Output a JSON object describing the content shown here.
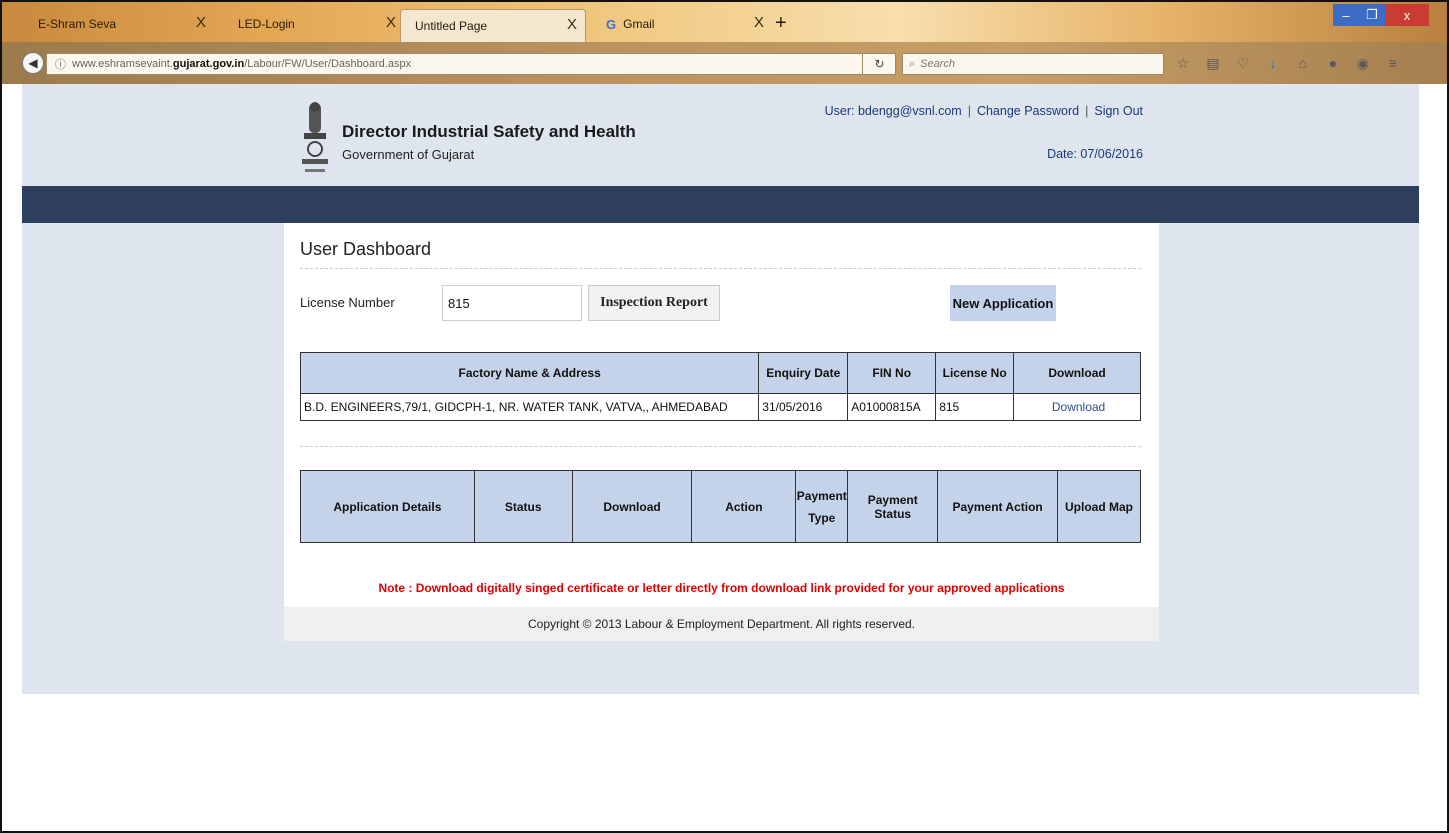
{
  "browser": {
    "tabs": [
      {
        "label": "E-Shram Seva",
        "active": false
      },
      {
        "label": "LED-Login",
        "active": false
      },
      {
        "label": "Untitled Page",
        "active": true
      },
      {
        "label": "Gmail",
        "active": false
      }
    ],
    "tab_close": "X",
    "new_tab": "+",
    "url_prefix": "www.eshramsevaint.",
    "url_host": "gujarat.gov.in",
    "url_path": "/Labour/FW/User/Dashboard.aspx",
    "search_placeholder": "Search",
    "window_controls": {
      "minimize": "–",
      "maximize": "❐",
      "close": "x"
    }
  },
  "header": {
    "org_title": "Director Industrial Safety and Health",
    "org_subtitle": "Government of Gujarat",
    "user_label": "User: bdengg@vsnl.com",
    "change_password": "Change Password",
    "sign_out": "Sign Out",
    "separator": "|",
    "date": "Date: 07/06/2016"
  },
  "dashboard": {
    "title": "User Dashboard",
    "license_label": "License Number",
    "license_value": "815",
    "inspection_button": "Inspection Report",
    "new_application_button": "New Application"
  },
  "license_table": {
    "columns": [
      "Factory Name & Address",
      "Enquiry Date",
      "FIN No",
      "License No",
      "Download"
    ],
    "rows": [
      [
        "B.D. ENGINEERS,79/1, GIDCPH-1, NR. WATER TANK, VATVA,, AHMEDABAD",
        "31/05/2016",
        "A01000815A",
        "815",
        "Download"
      ]
    ]
  },
  "application_table": {
    "columns": [
      "Application Details",
      "Status",
      "Download",
      "Action",
      "Payment Type",
      "Payment Status",
      "Payment Action",
      "Upload Map"
    ]
  },
  "note": "Note : Download digitally singed certificate or letter directly from download link provided for your approved applications",
  "footer": "Copyright © 2013 Labour & Employment Department. All rights reserved.",
  "colors": {
    "page_bg": "#dfe5ef",
    "nav_bar": "#2e3f5e",
    "table_header": "#c5d3ea",
    "note_text": "#e00000"
  }
}
